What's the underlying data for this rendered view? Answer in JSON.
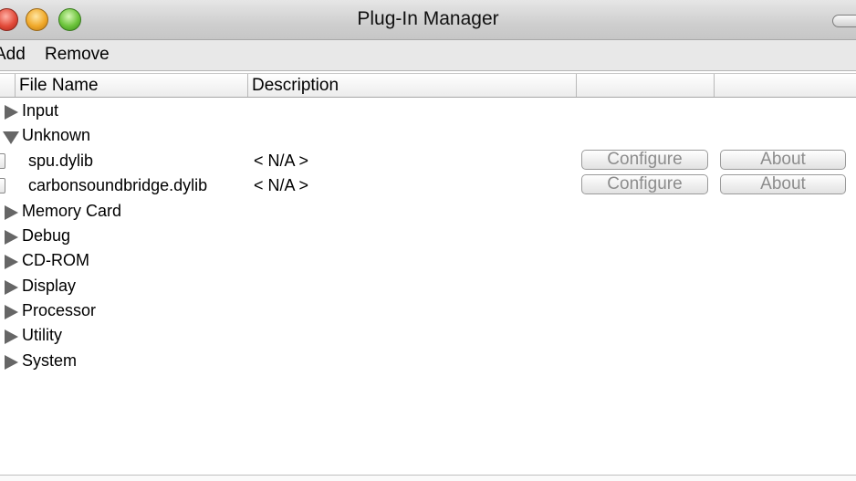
{
  "window": {
    "title": "Plug-In Manager"
  },
  "toolbar": {
    "add_label": "Add",
    "remove_label": "Remove"
  },
  "table": {
    "columns": [
      "File Name",
      "Description",
      "",
      ""
    ],
    "rows": [
      {
        "kind": "group",
        "label": "Input",
        "expanded": false
      },
      {
        "kind": "group",
        "label": "Unknown",
        "expanded": true
      },
      {
        "kind": "plugin",
        "file_name": "spu.dylib",
        "description": "< N/A >",
        "configure_label": "Configure",
        "about_label": "About"
      },
      {
        "kind": "plugin",
        "file_name": "carbonsoundbridge.dylib",
        "description": "< N/A >",
        "configure_label": "Configure",
        "about_label": "About"
      },
      {
        "kind": "group",
        "label": "Memory Card",
        "expanded": false
      },
      {
        "kind": "group",
        "label": "Debug",
        "expanded": false
      },
      {
        "kind": "group",
        "label": "CD-ROM",
        "expanded": false
      },
      {
        "kind": "group",
        "label": "Display",
        "expanded": false
      },
      {
        "kind": "group",
        "label": "Processor",
        "expanded": false
      },
      {
        "kind": "group",
        "label": "Utility",
        "expanded": false
      },
      {
        "kind": "group",
        "label": "System",
        "expanded": false
      }
    ]
  },
  "icons": {
    "close": "close-icon",
    "minimize": "minimize-icon",
    "zoom": "zoom-icon",
    "expand": "disclosure-triangle-right-icon",
    "collapse": "disclosure-triangle-down-icon"
  },
  "colors": {
    "disabled_button_text": "#8c8c8c",
    "triangle": "#666666"
  }
}
